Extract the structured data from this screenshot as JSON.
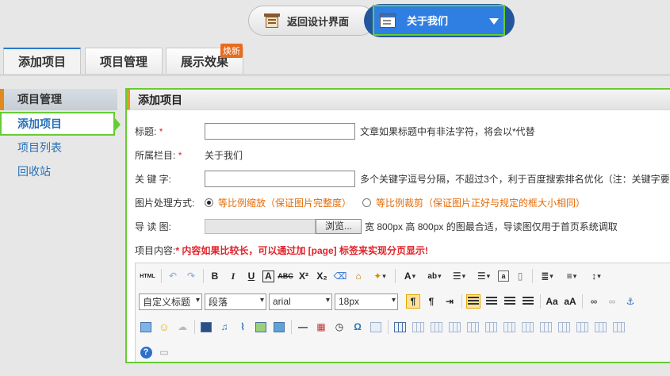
{
  "header": {
    "back_button": "返回设计界面",
    "current_menu": "关于我们"
  },
  "tabs": [
    {
      "label": "添加项目"
    },
    {
      "label": "项目管理"
    },
    {
      "label": "展示效果"
    }
  ],
  "tab_badge": "焕新",
  "sidebar": {
    "title": "项目管理",
    "items": [
      {
        "label": "添加项目"
      },
      {
        "label": "项目列表"
      },
      {
        "label": "回收站"
      }
    ]
  },
  "form": {
    "panel_title": "添加项目",
    "title_label": "标题:",
    "required_mark": "*",
    "title_hint": "文章如果标题中有非法字符，将会以*代替",
    "column_label": "所属栏目:",
    "column_value": "关于我们",
    "keywords_label": "关 键 字:",
    "keywords_hint": "多个关键字逗号分隔，不超过3个，利于百度搜索排名优化（注：关键字要",
    "image_mode_label": "图片处理方式:",
    "image_mode_option1": "等比例缩放（保证图片完整度）",
    "image_mode_option2": "等比例裁剪（保证图片正好与规定的框大小相同）",
    "thumb_label": "导 读 图:",
    "browse_label": "浏览...",
    "thumb_hint": "宽 800px 高 800px 的图最合适，导读图仅用于首页系统调取",
    "content_label": "项目内容:",
    "content_hint": "* 内容如果比较长，可以通过加 [page] 标签来实现分页显示!"
  },
  "editor": {
    "html_label": "HTML",
    "heading_select": "自定义标题",
    "paragraph_select": "段落",
    "font_select": "arial",
    "size_select": "18px",
    "icons": [
      "html-icon",
      "undo-icon",
      "redo-icon",
      "bold-icon",
      "italic-icon",
      "underline-icon",
      "font-border-icon",
      "strikethrough-icon",
      "superscript-icon",
      "subscript-icon",
      "eraser-icon",
      "format-brush-icon",
      "auto-format-icon",
      "font-color-icon",
      "highlight-icon",
      "ordered-list-icon",
      "unordered-list-icon",
      "select-all-icon",
      "clear-doc-icon",
      "line-height-icon",
      "indent-icon",
      "row-spacing-icon",
      "ltr-icon",
      "rtl-icon",
      "indent-block-icon",
      "align-left-icon",
      "align-center-icon",
      "align-right-icon",
      "justify-icon",
      "uppercase-icon",
      "lowercase-icon",
      "link-icon",
      "unlink-icon",
      "anchor-icon",
      "image-icon",
      "emotion-icon",
      "scrawl-icon",
      "video-icon",
      "music-icon",
      "attachment-icon",
      "map-icon",
      "gmap-icon",
      "horizontal-rule-icon",
      "date-icon",
      "time-icon",
      "special-char-icon",
      "snapscreen-icon",
      "table-icon",
      "help-icon",
      "template-icon"
    ],
    "help_symbol": "?"
  }
}
